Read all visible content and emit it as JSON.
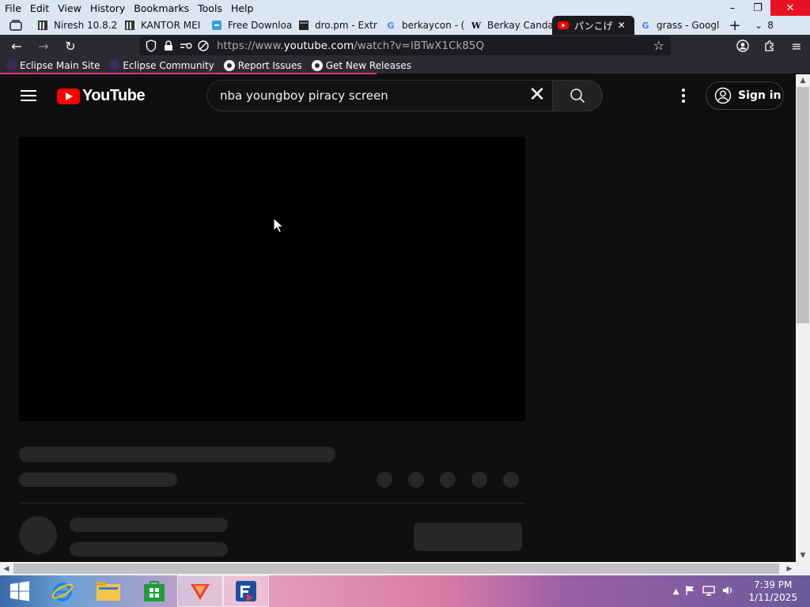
{
  "menubar": {
    "items": [
      "File",
      "Edit",
      "View",
      "History",
      "Bookmarks",
      "Tools",
      "Help"
    ]
  },
  "window_buttons": {
    "minimize": "–",
    "restore": "❐",
    "close": "✕"
  },
  "tabs": [
    {
      "title": "Niresh 10.8.2",
      "icon": "archive-icon"
    },
    {
      "title": "KANTOR MEI",
      "icon": "archive-icon"
    },
    {
      "title": "Free Downloa",
      "icon": "download-site-icon"
    },
    {
      "title": "dro.pm - Extr",
      "icon": "terminal-icon"
    },
    {
      "title": "berkaycon - (",
      "icon": "google-icon"
    },
    {
      "title": "Berkay Canda",
      "icon": "wikipedia-icon"
    },
    {
      "title": "パンこげ",
      "icon": "youtube-icon",
      "active": true
    },
    {
      "title": "grass - Googl",
      "icon": "google-icon"
    }
  ],
  "tab_overflow_count": "8",
  "url": {
    "prefix": "https://www.",
    "domain": "youtube.com",
    "path": "/watch?v=IBTwX1Ck85Q"
  },
  "bookmarks": [
    "Eclipse Main Site",
    "Eclipse Community",
    "Report Issues",
    "Get New Releases"
  ],
  "youtube": {
    "logo_text": "YouTube",
    "search_value": "nba youngboy piracy screen",
    "signin_label": "Sign in"
  },
  "taskbar": {
    "apps": [
      "start-button",
      "internet-explorer-icon",
      "file-explorer-icon",
      "windows-store-icon",
      "firefox-icon",
      "filezilla-icon"
    ],
    "time": "7:39 PM",
    "date": "1/11/2025"
  },
  "colors": {
    "youtube_red": "#ff0000",
    "page_bg": "#0f0f0f",
    "skeleton": "#272727",
    "tab_active": "#1c1b22",
    "toolbar": "#2b2a33"
  }
}
